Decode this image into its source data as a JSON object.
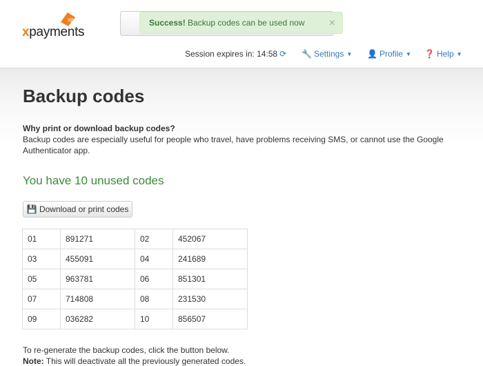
{
  "brand": {
    "logo_text_x": "x",
    "logo_text_rest": "payments",
    "accent": "#f07f1e"
  },
  "alert": {
    "strong": "Success!",
    "message": "Backup codes can be used now",
    "close": "×"
  },
  "nav": {
    "session_label": "Session expires in:",
    "session_time": "14:58",
    "settings": "Settings",
    "profile": "Profile",
    "help": "Help"
  },
  "page": {
    "title": "Backup codes",
    "why_heading": "Why print or download backup codes?",
    "description": "Backup codes are especially useful for people who travel, have problems receiving SMS, or cannot use the Google Authenticator app.",
    "unused_message": "You have 10 unused codes",
    "download_button": "Download or print codes",
    "codes": [
      {
        "n1": "01",
        "c1": "891271",
        "n2": "02",
        "c2": "452067"
      },
      {
        "n1": "03",
        "c1": "455091",
        "n2": "04",
        "c2": "241689"
      },
      {
        "n1": "05",
        "c1": "963781",
        "n2": "06",
        "c2": "851301"
      },
      {
        "n1": "07",
        "c1": "714808",
        "n2": "08",
        "c2": "231530"
      },
      {
        "n1": "09",
        "c1": "036282",
        "n2": "10",
        "c2": "856507"
      }
    ],
    "regen_text": "To re-generate the backup codes, click the button below.",
    "note_label": "Note:",
    "note_text": " This will deactivate all the previously generated codes."
  }
}
